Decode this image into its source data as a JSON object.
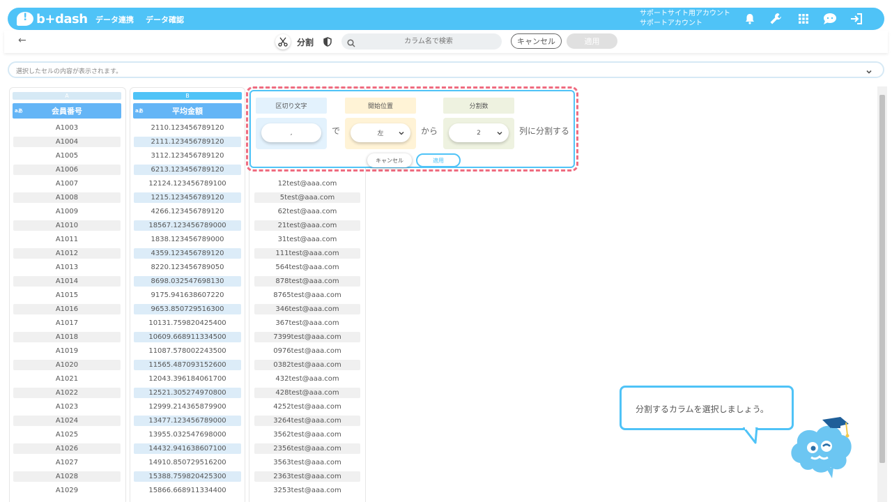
{
  "app": {
    "logo": "b+dash",
    "colors": {
      "accent": "#4fc3f7",
      "highlight": "#ef6c80",
      "header_blue": "#64b5f6"
    }
  },
  "header": {
    "nav": [
      "データ連携",
      "データ確認"
    ],
    "account": [
      "サポートサイト用アカウント",
      "サポートアカウント"
    ],
    "icons": [
      "bell-icon",
      "wrench-icon",
      "grid-icon",
      "chat-icon",
      "logout-icon"
    ]
  },
  "toolbar": {
    "back": "←",
    "title": "分割",
    "search_placeholder": "カラム名で検索",
    "cancel": "キャンセル",
    "apply": "適用"
  },
  "cellbar": {
    "placeholder": "選択したセルの内容が表示されます。"
  },
  "columns": [
    {
      "letter": "A",
      "header": "会員番号",
      "type": "aあ",
      "rows": [
        "A1003",
        "A1004",
        "A1005",
        "A1006",
        "A1007",
        "A1008",
        "A1009",
        "A1010",
        "A1011",
        "A1012",
        "A1013",
        "A1014",
        "A1015",
        "A1016",
        "A1017",
        "A1018",
        "A1019",
        "A1020",
        "A1021",
        "A1022",
        "A1023",
        "A1024",
        "A1025",
        "A1026",
        "A1027",
        "A1028",
        "A1029"
      ]
    },
    {
      "letter": "B",
      "header": "平均金額",
      "type": "aあ",
      "rows": [
        "2110.123456789120",
        "2111.123456789120",
        "3112.123456789120",
        "6213.123456789120",
        "12124.123456789100",
        "1215.123456789120",
        "4266.123456789120",
        "18567.123456789000",
        "1838.123456789000",
        "4359.123456789120",
        "8220.123456789050",
        "8698.032547698130",
        "9175.941638607220",
        "9653.850729516300",
        "10131.759820425400",
        "10609.668911334500",
        "11087.578002243500",
        "11565.487093152600",
        "12043.396184061700",
        "12521.305274970800",
        "12999.214365879900",
        "13477.123456789000",
        "13955.032547698000",
        "14432.941638607100",
        "14910.850729516200",
        "15388.759820425300",
        "15866.668911334400"
      ]
    },
    {
      "letter": "",
      "header": "",
      "type": "",
      "rows": [
        "",
        "",
        "",
        "",
        "12test@aaa.com",
        "5test@aaa.com",
        "62test@aaa.com",
        "21test@aaa.com",
        "31test@aaa.com",
        "111test@aaa.com",
        "564test@aaa.com",
        "878test@aaa.com",
        "8765test@aaa.com",
        "346test@aaa.com",
        "367test@aaa.com",
        "7399test@aaa.com",
        "0976test@aaa.com",
        "0382test@aaa.com",
        "432test@aaa.com",
        "428test@aaa.com",
        "4252test@aaa.com",
        "3264test@aaa.com",
        "3562test@aaa.com",
        "2356test@aaa.com",
        "3563test@aaa.com",
        "2363test@aaa.com",
        "3253test@aaa.com"
      ]
    }
  ],
  "popup": {
    "delimiter_label": "区切り文字",
    "delimiter_value": ",",
    "de": "で",
    "start_label": "開始位置",
    "start_value": "左",
    "kara": "から",
    "count_label": "分割数",
    "count_value": "2",
    "suffix": "列に分割する",
    "cancel": "キャンセル",
    "apply": "適用"
  },
  "guide": {
    "message": "分割するカラムを選択しましょう。"
  }
}
